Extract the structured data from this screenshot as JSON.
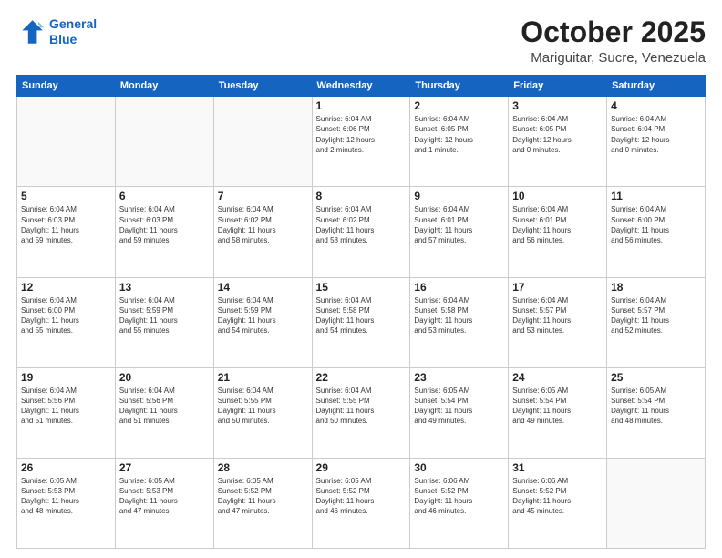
{
  "header": {
    "logo_line1": "General",
    "logo_line2": "Blue",
    "month": "October 2025",
    "location": "Mariguitar, Sucre, Venezuela"
  },
  "weekdays": [
    "Sunday",
    "Monday",
    "Tuesday",
    "Wednesday",
    "Thursday",
    "Friday",
    "Saturday"
  ],
  "weeks": [
    [
      {
        "day": "",
        "info": ""
      },
      {
        "day": "",
        "info": ""
      },
      {
        "day": "",
        "info": ""
      },
      {
        "day": "1",
        "info": "Sunrise: 6:04 AM\nSunset: 6:06 PM\nDaylight: 12 hours\nand 2 minutes."
      },
      {
        "day": "2",
        "info": "Sunrise: 6:04 AM\nSunset: 6:05 PM\nDaylight: 12 hours\nand 1 minute."
      },
      {
        "day": "3",
        "info": "Sunrise: 6:04 AM\nSunset: 6:05 PM\nDaylight: 12 hours\nand 0 minutes."
      },
      {
        "day": "4",
        "info": "Sunrise: 6:04 AM\nSunset: 6:04 PM\nDaylight: 12 hours\nand 0 minutes."
      }
    ],
    [
      {
        "day": "5",
        "info": "Sunrise: 6:04 AM\nSunset: 6:03 PM\nDaylight: 11 hours\nand 59 minutes."
      },
      {
        "day": "6",
        "info": "Sunrise: 6:04 AM\nSunset: 6:03 PM\nDaylight: 11 hours\nand 59 minutes."
      },
      {
        "day": "7",
        "info": "Sunrise: 6:04 AM\nSunset: 6:02 PM\nDaylight: 11 hours\nand 58 minutes."
      },
      {
        "day": "8",
        "info": "Sunrise: 6:04 AM\nSunset: 6:02 PM\nDaylight: 11 hours\nand 58 minutes."
      },
      {
        "day": "9",
        "info": "Sunrise: 6:04 AM\nSunset: 6:01 PM\nDaylight: 11 hours\nand 57 minutes."
      },
      {
        "day": "10",
        "info": "Sunrise: 6:04 AM\nSunset: 6:01 PM\nDaylight: 11 hours\nand 56 minutes."
      },
      {
        "day": "11",
        "info": "Sunrise: 6:04 AM\nSunset: 6:00 PM\nDaylight: 11 hours\nand 56 minutes."
      }
    ],
    [
      {
        "day": "12",
        "info": "Sunrise: 6:04 AM\nSunset: 6:00 PM\nDaylight: 11 hours\nand 55 minutes."
      },
      {
        "day": "13",
        "info": "Sunrise: 6:04 AM\nSunset: 5:59 PM\nDaylight: 11 hours\nand 55 minutes."
      },
      {
        "day": "14",
        "info": "Sunrise: 6:04 AM\nSunset: 5:59 PM\nDaylight: 11 hours\nand 54 minutes."
      },
      {
        "day": "15",
        "info": "Sunrise: 6:04 AM\nSunset: 5:58 PM\nDaylight: 11 hours\nand 54 minutes."
      },
      {
        "day": "16",
        "info": "Sunrise: 6:04 AM\nSunset: 5:58 PM\nDaylight: 11 hours\nand 53 minutes."
      },
      {
        "day": "17",
        "info": "Sunrise: 6:04 AM\nSunset: 5:57 PM\nDaylight: 11 hours\nand 53 minutes."
      },
      {
        "day": "18",
        "info": "Sunrise: 6:04 AM\nSunset: 5:57 PM\nDaylight: 11 hours\nand 52 minutes."
      }
    ],
    [
      {
        "day": "19",
        "info": "Sunrise: 6:04 AM\nSunset: 5:56 PM\nDaylight: 11 hours\nand 51 minutes."
      },
      {
        "day": "20",
        "info": "Sunrise: 6:04 AM\nSunset: 5:56 PM\nDaylight: 11 hours\nand 51 minutes."
      },
      {
        "day": "21",
        "info": "Sunrise: 6:04 AM\nSunset: 5:55 PM\nDaylight: 11 hours\nand 50 minutes."
      },
      {
        "day": "22",
        "info": "Sunrise: 6:04 AM\nSunset: 5:55 PM\nDaylight: 11 hours\nand 50 minutes."
      },
      {
        "day": "23",
        "info": "Sunrise: 6:05 AM\nSunset: 5:54 PM\nDaylight: 11 hours\nand 49 minutes."
      },
      {
        "day": "24",
        "info": "Sunrise: 6:05 AM\nSunset: 5:54 PM\nDaylight: 11 hours\nand 49 minutes."
      },
      {
        "day": "25",
        "info": "Sunrise: 6:05 AM\nSunset: 5:54 PM\nDaylight: 11 hours\nand 48 minutes."
      }
    ],
    [
      {
        "day": "26",
        "info": "Sunrise: 6:05 AM\nSunset: 5:53 PM\nDaylight: 11 hours\nand 48 minutes."
      },
      {
        "day": "27",
        "info": "Sunrise: 6:05 AM\nSunset: 5:53 PM\nDaylight: 11 hours\nand 47 minutes."
      },
      {
        "day": "28",
        "info": "Sunrise: 6:05 AM\nSunset: 5:52 PM\nDaylight: 11 hours\nand 47 minutes."
      },
      {
        "day": "29",
        "info": "Sunrise: 6:05 AM\nSunset: 5:52 PM\nDaylight: 11 hours\nand 46 minutes."
      },
      {
        "day": "30",
        "info": "Sunrise: 6:06 AM\nSunset: 5:52 PM\nDaylight: 11 hours\nand 46 minutes."
      },
      {
        "day": "31",
        "info": "Sunrise: 6:06 AM\nSunset: 5:52 PM\nDaylight: 11 hours\nand 45 minutes."
      },
      {
        "day": "",
        "info": ""
      }
    ]
  ]
}
